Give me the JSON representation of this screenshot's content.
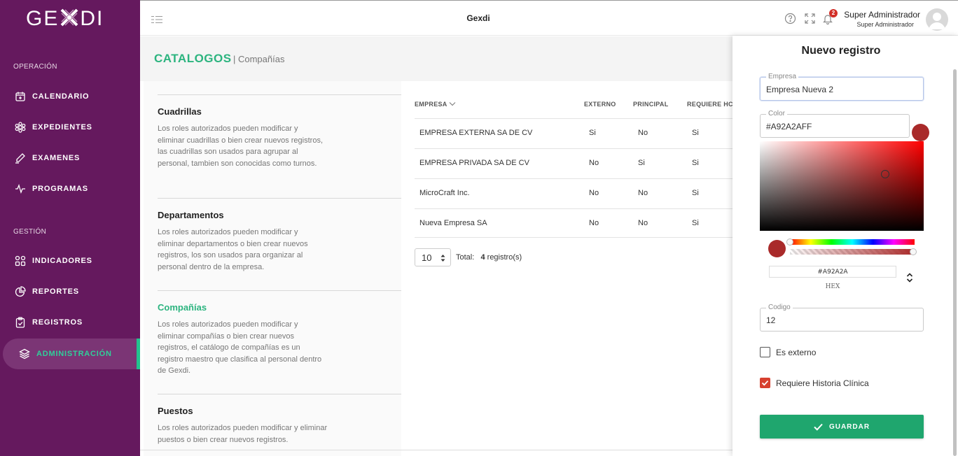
{
  "brand": {
    "logo_text_left": "GE",
    "logo_text_right": "DI"
  },
  "sidebar": {
    "sections": [
      {
        "label": "OPERACIÓN"
      },
      {
        "label": "GESTIÓN"
      }
    ],
    "items": [
      {
        "label": "CALENDARIO",
        "icon": "calendar-plus-icon"
      },
      {
        "label": "EXPEDIENTES",
        "icon": "gear-flower-icon"
      },
      {
        "label": "EXAMENES",
        "icon": "pen-icon"
      },
      {
        "label": "PROGRAMAS",
        "icon": "pulse-icon"
      },
      {
        "label": "INDICADORES",
        "icon": "grid-icon"
      },
      {
        "label": "REPORTES",
        "icon": "pie-chart-icon"
      },
      {
        "label": "REGISTROS",
        "icon": "clipboard-check-icon"
      },
      {
        "label": "ADMINISTRACIÓN",
        "icon": "layers-icon",
        "active": true
      }
    ]
  },
  "topbar": {
    "title": "Gexdi",
    "notifications_count": "2",
    "user_name": "Super Administrador",
    "user_role": "Super Administrador"
  },
  "page": {
    "title": "CATALOGOS",
    "subtitle": "| Compañías"
  },
  "catalogs": [
    {
      "title": "Cuadrillas",
      "desc": "Los roles autorizados pueden modificar y eliminar cuadrillas o bien crear nuevos registros, las cuadrillas son usados para agrupar al personal, tambien son conocidas como turnos."
    },
    {
      "title": "Departamentos",
      "desc": "Los roles autorizados pueden modificar y eliminar departamentos o bien crear nuevos registros, los son usados para organizar al personal dentro de la empresa."
    },
    {
      "title": "Compañías",
      "desc": "Los roles autorizados pueden modificar y eliminar compañías o bien crear nuevos registros, el catálogo de compañías es un registro maestro que clasifica al personal dentro de Gexdi.",
      "active": true
    },
    {
      "title": "Puestos",
      "desc": "Los roles autorizados pueden modificar y eliminar puestos o bien crear nuevos registros."
    }
  ],
  "table": {
    "headers": [
      "EMPRESA",
      "EXTERNO",
      "PRINCIPAL",
      "REQUIERE HC"
    ],
    "rows": [
      [
        "EMPRESA EXTERNA SA DE CV",
        "Si",
        "No",
        "Si"
      ],
      [
        "EMPRESA PRIVADA SA DE CV",
        "No",
        "Si",
        "Si"
      ],
      [
        "MicroCraft Inc.",
        "No",
        "No",
        "Si"
      ],
      [
        "Nueva Empresa SA",
        "No",
        "No",
        "Si"
      ]
    ],
    "page_size": "10",
    "total_label": "Total:",
    "total_count": "4",
    "total_suffix": "registro(s)"
  },
  "form": {
    "title": "Nuevo registro",
    "empresa_label": "Empresa",
    "empresa_value": "Empresa Nueva 2",
    "color_label": "Color",
    "color_value": "#A92A2AFF",
    "color_hex": "#A92A2A",
    "hex_label": "HEX",
    "codigo_label": "Codigo",
    "codigo_value": "12",
    "es_externo_label": "Es externo",
    "es_externo_checked": false,
    "requiere_label": "Requiere Historia Clínica",
    "requiere_checked": true,
    "save_label": "GUARDAR"
  },
  "colors": {
    "sidebar_bg": "#65195e",
    "accent_green": "#2cb47f",
    "selected_color": "#a92a2a",
    "button_green": "#1fa66e"
  }
}
